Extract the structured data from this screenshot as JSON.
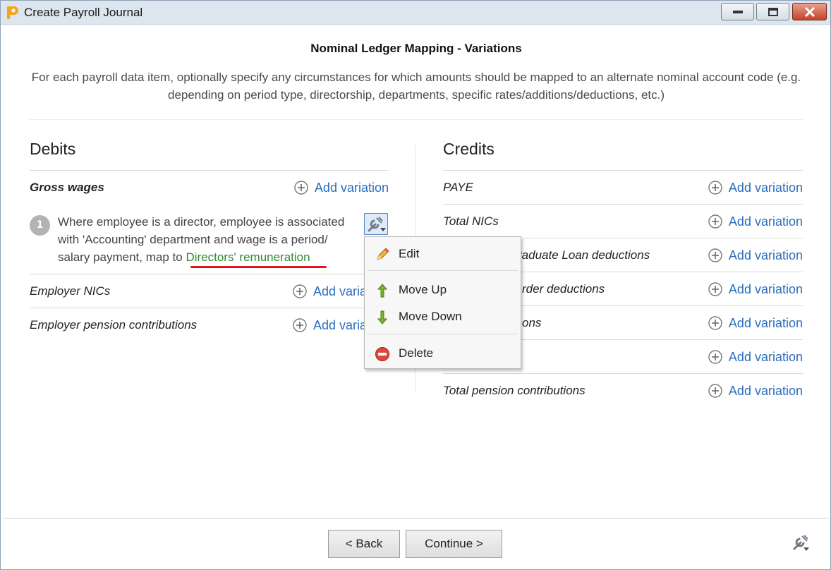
{
  "window": {
    "title": "Create Payroll Journal"
  },
  "header": {
    "title": "Nominal Ledger Mapping - Variations",
    "description": "For each payroll data item, optionally specify any circumstances for which amounts should be mapped to an alternate nominal account code (e.g. depending on period type, directorship, departments, specific rates/additions/deductions, etc.)"
  },
  "debits": {
    "title": "Debits",
    "items": [
      {
        "label": "Gross wages",
        "add_label": "Add variation"
      },
      {
        "label": "Employer NICs",
        "add_label": "Add varia"
      },
      {
        "label": "Employer pension contributions",
        "add_label": "Add varia"
      }
    ],
    "variation": {
      "number": "1",
      "text": "Where employee is a director, employee is associated with 'Accounting' department and wage is a period/ salary payment, map to",
      "account": "Directors' remuneration"
    }
  },
  "credits": {
    "title": "Credits",
    "items": [
      {
        "label": "PAYE",
        "add_label": "Add variation"
      },
      {
        "label": "Total NICs",
        "add_label": "Add variation"
      },
      {
        "label": "raduate Loan deductions",
        "add_label": "Add variation"
      },
      {
        "label": "rder deductions",
        "add_label": "Add variation"
      },
      {
        "label": "ons",
        "add_label": "Add variation"
      },
      {
        "label": "",
        "add_label": "Add variation"
      },
      {
        "label": "Total pension contributions",
        "add_label": "Add variation"
      }
    ]
  },
  "context_menu": {
    "items": [
      {
        "label": "Edit",
        "icon": "pencil-icon"
      },
      {
        "label": "Move Up",
        "icon": "arrow-up-icon"
      },
      {
        "label": "Move Down",
        "icon": "arrow-down-icon"
      },
      {
        "label": "Delete",
        "icon": "delete-icon"
      }
    ]
  },
  "footer": {
    "back_label": "< Back",
    "continue_label": "Continue >"
  },
  "colors": {
    "link": "#2a6ebd",
    "account": "#2e8b2e",
    "underline": "#e0161e"
  }
}
